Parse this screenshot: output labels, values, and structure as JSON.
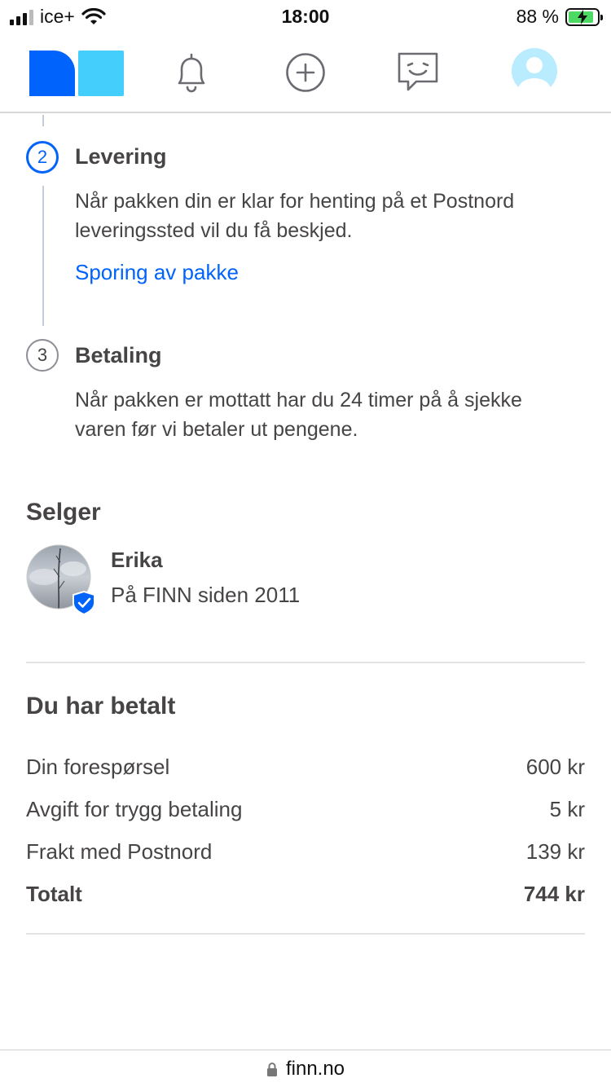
{
  "status_bar": {
    "carrier": "ice+",
    "time": "18:00",
    "battery": "88 %"
  },
  "nav": {
    "items": [
      {
        "name": "finn-logo",
        "icon": "finn-logo"
      },
      {
        "name": "notifications",
        "icon": "bell-icon"
      },
      {
        "name": "new-ad",
        "icon": "plus-circle-icon"
      },
      {
        "name": "messages",
        "icon": "chat-smile-icon"
      },
      {
        "name": "profile",
        "icon": "avatar-icon"
      }
    ]
  },
  "steps": [
    {
      "number": "2",
      "title": "Levering",
      "text_line1": "Når pakken din er klar for henting på et Postnord",
      "text_line2": "leveringssted vil du få beskjed.",
      "link": "Sporing av pakke"
    },
    {
      "number": "3",
      "title": "Betaling",
      "text_line1": "Når pakken er mottatt har du 24 timer på å sjekke",
      "text_line2": "varen før vi betaler ut pengene."
    }
  ],
  "seller": {
    "heading": "Selger",
    "name": "Erika",
    "since": "På FINN siden 2011"
  },
  "payment": {
    "heading": "Du har betalt",
    "rows": [
      {
        "label": "Din forespørsel",
        "value": "600 kr"
      },
      {
        "label": "Avgift for trygg betaling",
        "value": "5 kr"
      },
      {
        "label": "Frakt med Postnord",
        "value": "139 kr"
      }
    ],
    "total": {
      "label": "Totalt",
      "value": "744 kr"
    }
  },
  "url_bar": {
    "url": "finn.no"
  },
  "colors": {
    "accent": "#0063fb",
    "text": "#474445",
    "logo_dark": "#0063fb",
    "logo_light": "#06befb"
  }
}
